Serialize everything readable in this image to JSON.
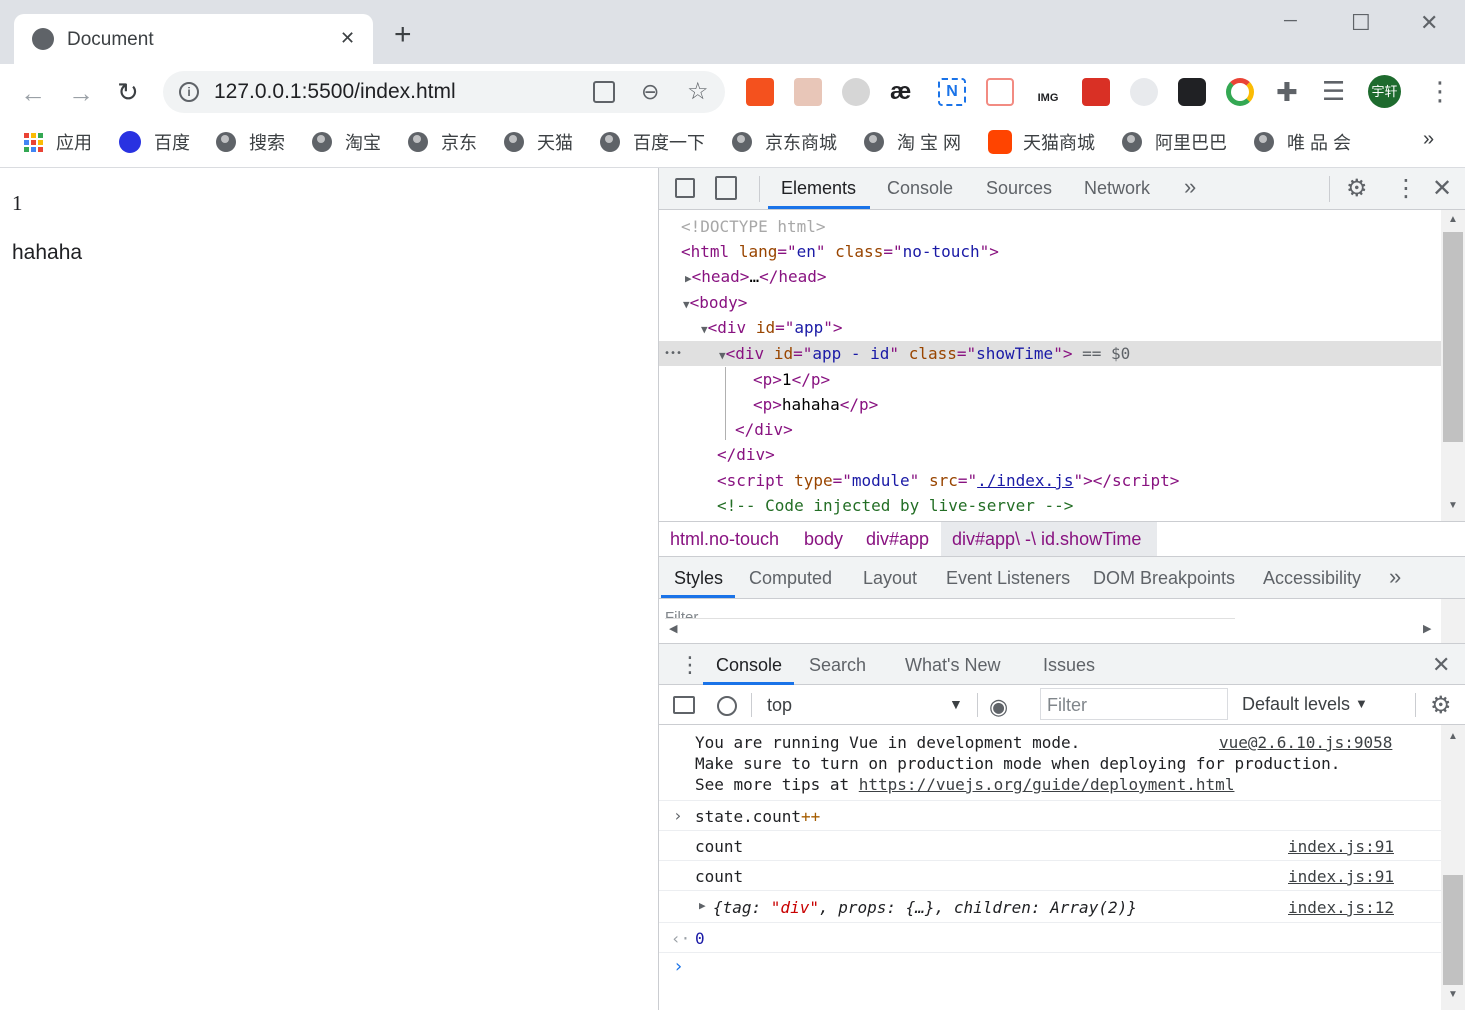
{
  "tab": {
    "title": "Document",
    "close": "✕",
    "new_tab": "+"
  },
  "window": {
    "minimize": "─",
    "maximize": "☐",
    "close": "✕"
  },
  "address": {
    "url": "127.0.0.1:5500/index.html"
  },
  "profile": {
    "name": "宇轩"
  },
  "bookmarks": [
    "应用",
    "百度",
    "搜索",
    "淘宝",
    "京东",
    "天猫",
    "百度一下",
    "京东商城",
    "淘 宝 网",
    "天猫商城",
    "阿里巴巴",
    "唯 品 会"
  ],
  "bookmarks_more": "»",
  "page": {
    "p1": "1",
    "p2": "hahaha"
  },
  "devtools": {
    "tabs": [
      "Elements",
      "Console",
      "Sources",
      "Network"
    ],
    "more": "»",
    "elements": {
      "doctype": "<!DOCTYPE html>",
      "html_tag": "html",
      "html_lang": "en",
      "html_class": "no-touch",
      "head": "head",
      "head_ellipsis": "…",
      "body": "body",
      "div": "div",
      "app_id": "app",
      "inner_id": "app - id",
      "inner_class": "showTime",
      "eq": "== $0",
      "p": "p",
      "p1": "1",
      "p2": "hahaha",
      "script_type": "module",
      "script_src": "./index.js",
      "script": "script",
      "comment": "<!-- Code injected by live-server -->",
      "dots": "•••"
    },
    "breadcrumbs": [
      "html.no-touch",
      "body",
      "div#app",
      "div#app\\ -\\ id.showTime"
    ],
    "style_tabs": [
      "Styles",
      "Computed",
      "Layout",
      "Event Listeners",
      "DOM Breakpoints",
      "Accessibility"
    ],
    "styles_filter": "Filter",
    "drawer_tabs": [
      "Console",
      "Search",
      "What's New",
      "Issues"
    ],
    "console_toolbar": {
      "context": "top",
      "filter_placeholder": "Filter",
      "levels": "Default levels"
    },
    "console": {
      "vue_line1": "You are running Vue in development mode.",
      "vue_line2": "Make sure to turn on production mode when deploying for production.",
      "vue_line3_prefix": "See more tips at ",
      "vue_link": "https://vuejs.org/guide/deployment.html",
      "vue_source": "vue@2.6.10.js:9058",
      "input_cmd": "state.count",
      "input_op": "++",
      "log1": "count",
      "log1_src": "index.js:91",
      "log2": "count",
      "log2_src": "index.js:91",
      "obj_prefix": "{tag: ",
      "obj_tag": "\"div\"",
      "obj_mid": ", props: {…}, children: ",
      "obj_children": "Array(2)",
      "obj_suffix": "}",
      "obj_src": "index.js:12",
      "result": "0"
    }
  },
  "colors": {
    "accent": "#1a73e8",
    "tag": "#881280",
    "attr": "#994500",
    "value": "#1a1aa6",
    "selected_row": "#e0e0e0"
  }
}
